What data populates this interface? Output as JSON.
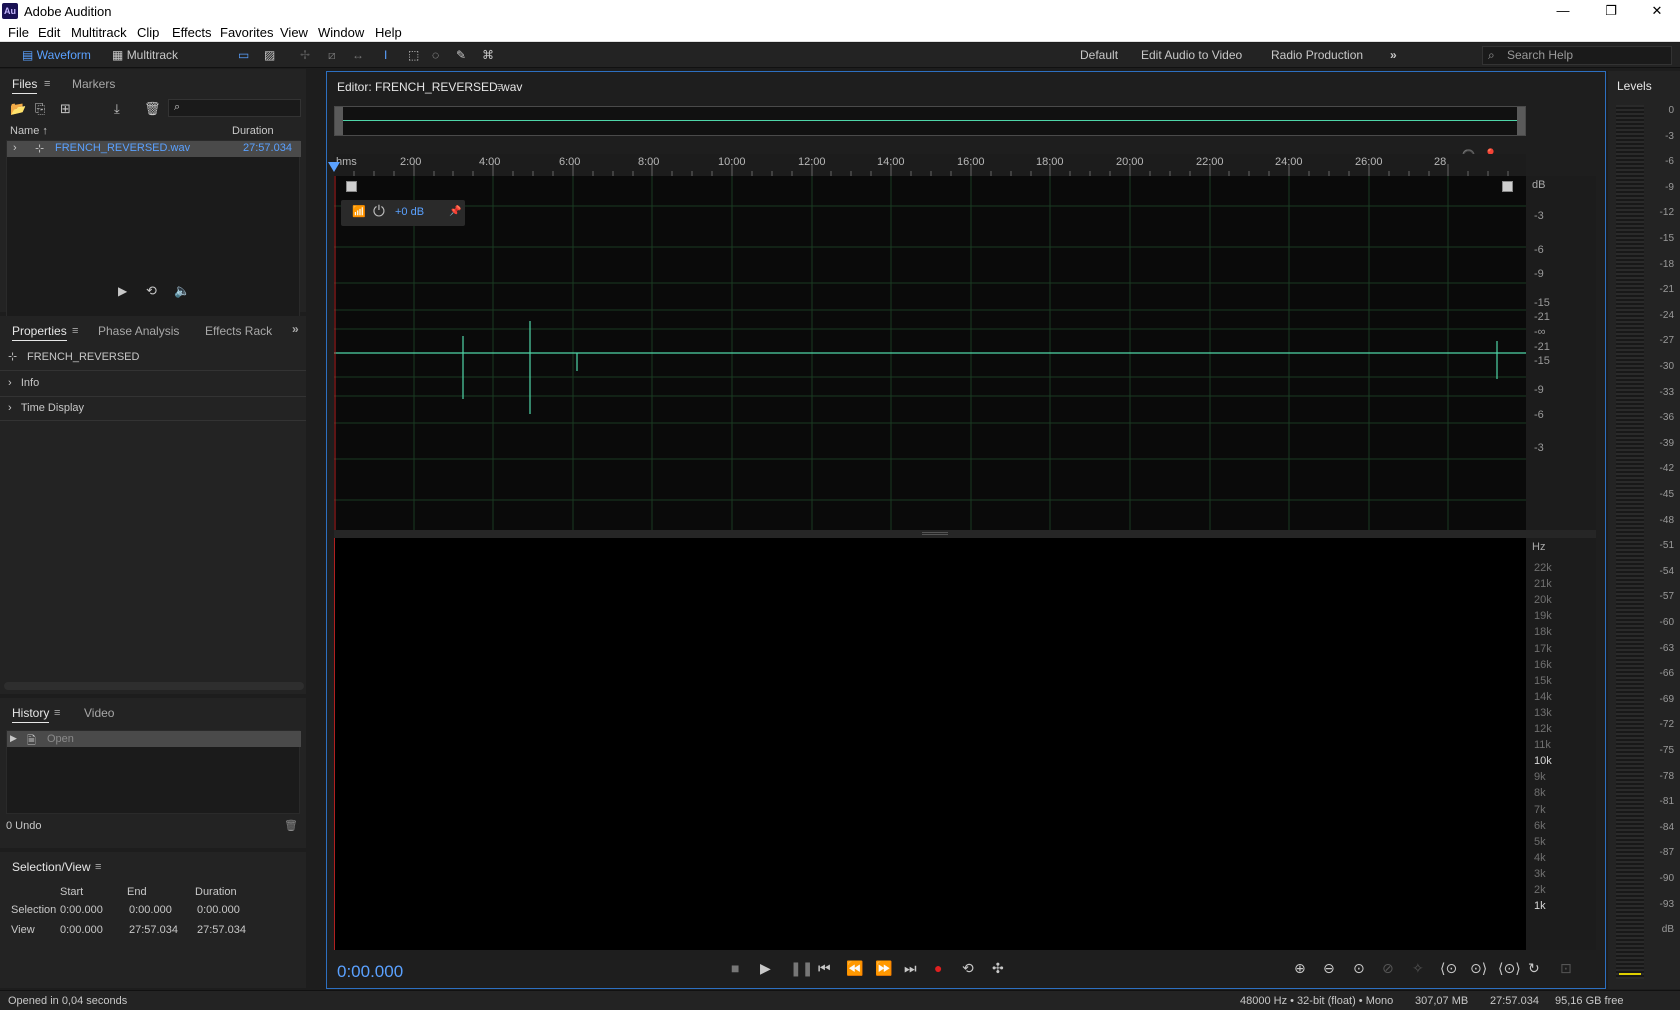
{
  "app": {
    "title": "Adobe Audition",
    "logo_text": "Au"
  },
  "window_controls": {
    "minimize": "—",
    "restore": "❐",
    "close": "✕"
  },
  "menu": [
    "File",
    "Edit",
    "Multitrack",
    "Clip",
    "Effects",
    "Favorites",
    "View",
    "Window",
    "Help"
  ],
  "toolbar": {
    "waveform_label": "Waveform",
    "multitrack_label": "Multitrack",
    "workspaces": [
      "Default",
      "Edit Audio to Video",
      "Radio Production"
    ],
    "more": "»",
    "search_placeholder": "Search Help"
  },
  "files_panel": {
    "tabs": [
      "Files",
      "Markers"
    ],
    "columns": {
      "name": "Name",
      "duration": "Duration"
    },
    "items": [
      {
        "name": "FRENCH_REVERSED.wav",
        "duration": "27:57.034"
      }
    ]
  },
  "properties_panel": {
    "tabs": [
      "Properties",
      "Phase Analysis",
      "Effects Rack"
    ],
    "more": "»",
    "file_name": "FRENCH_REVERSED",
    "sections": [
      "Info",
      "Time Display"
    ]
  },
  "history_panel": {
    "tabs": [
      "History",
      "Video"
    ],
    "items": [
      {
        "label": "Open"
      }
    ],
    "undo_count": "0 Undo"
  },
  "selection_view": {
    "title": "Selection/View",
    "columns": [
      "Start",
      "End",
      "Duration"
    ],
    "rows": [
      {
        "label": "Selection",
        "start": "0:00.000",
        "end": "0:00.000",
        "duration": "0:00.000"
      },
      {
        "label": "View",
        "start": "0:00.000",
        "end": "27:57.034",
        "duration": "27:57.034"
      }
    ]
  },
  "editor": {
    "title": "Editor: FRENCH_REVERSED.wav",
    "ruler_labels": [
      "hms",
      "2:00",
      "4:00",
      "6:00",
      "8:00",
      "10:00",
      "12:00",
      "14:00",
      "16:00",
      "18:00",
      "20:00",
      "22:00",
      "24:00",
      "26:00",
      "28"
    ],
    "gain": "+0 dB",
    "db_unit": "dB",
    "db_labels": [
      "-3",
      "-6",
      "-9",
      "-15",
      "-21",
      "-∞",
      "-21",
      "-15",
      "-9",
      "-6",
      "-3"
    ],
    "hz_unit": "Hz",
    "hz_labels": [
      "22k",
      "21k",
      "20k",
      "19k",
      "18k",
      "17k",
      "16k",
      "15k",
      "14k",
      "13k",
      "12k",
      "11k",
      "10k",
      "9k",
      "8k",
      "7k",
      "6k",
      "5k",
      "4k",
      "3k",
      "2k",
      "1k"
    ],
    "timecode": "0:00.000"
  },
  "levels_panel": {
    "title": "Levels",
    "db_labels": [
      "0",
      "-3",
      "-6",
      "-9",
      "-12",
      "-15",
      "-18",
      "-21",
      "-24",
      "-27",
      "-30",
      "-33",
      "-36",
      "-39",
      "-42",
      "-45",
      "-48",
      "-51",
      "-54",
      "-57",
      "-60",
      "-63",
      "-66",
      "-69",
      "-72",
      "-75",
      "-78",
      "-81",
      "-84",
      "-87",
      "-90",
      "-93",
      "dB"
    ]
  },
  "status": {
    "message": "Opened in 0,04 seconds",
    "format": "48000 Hz • 32-bit (float) • Mono",
    "size": "307,07 MB",
    "duration": "27:57.034",
    "free": "95,16 GB free"
  },
  "colors": {
    "accent": "#5aa1ff",
    "waveform": "#4fd5a8",
    "record": "#e02020"
  }
}
